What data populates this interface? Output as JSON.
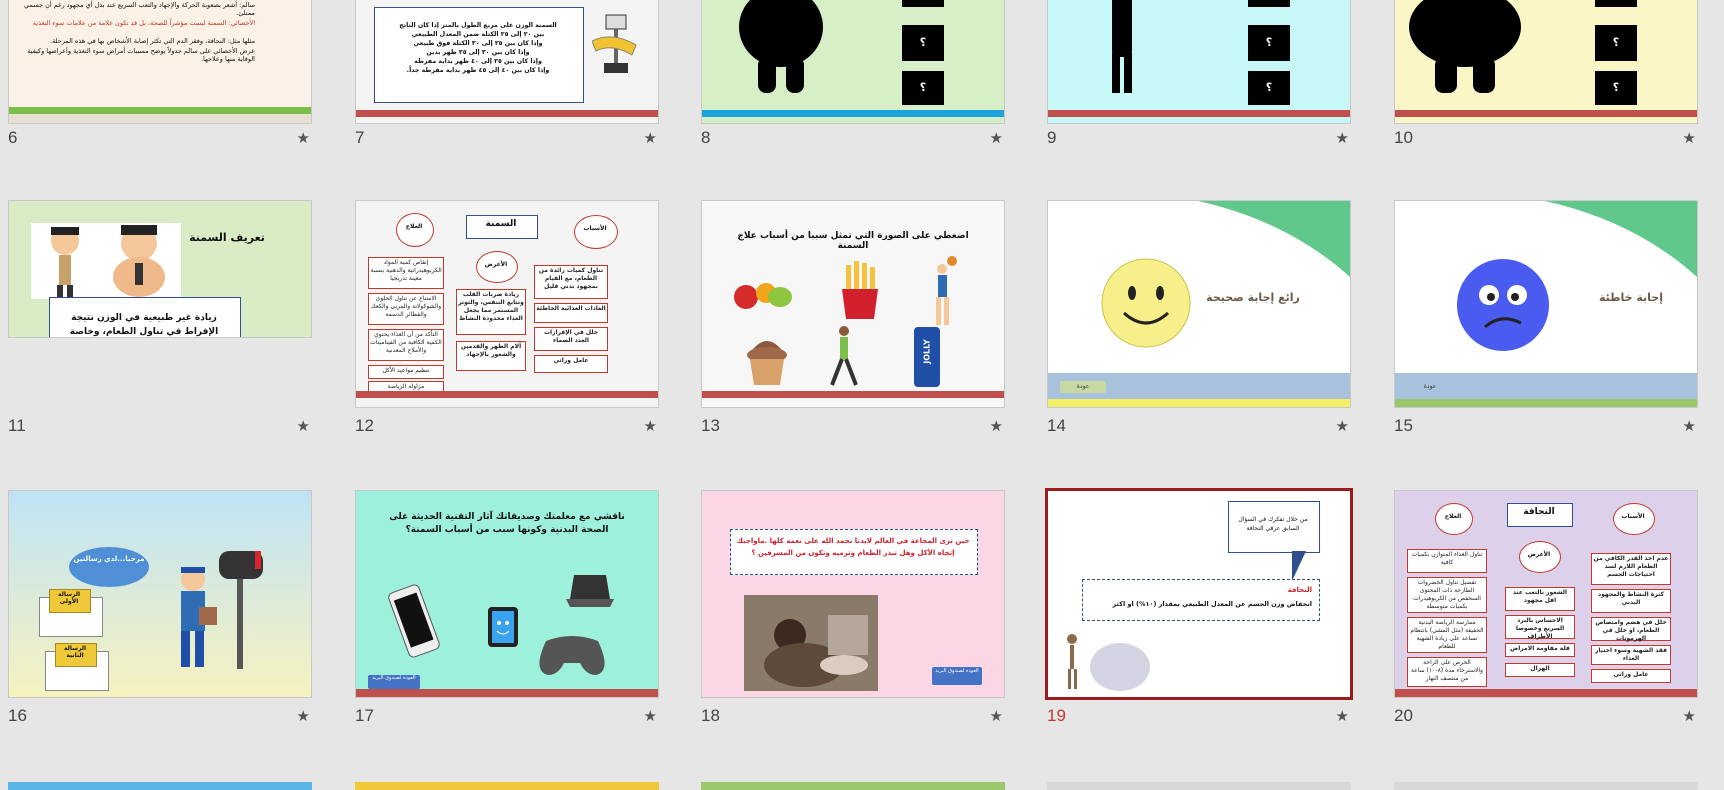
{
  "slides": [
    {
      "number": "6",
      "star": "★",
      "line1": "سالم: أشعر بصعوبة الحركة والإجهاد والتعب السريع عند بذل أي مجهود رغم أن جسمي ممتلئ.",
      "line2": "الأخصائي: السمنة ليست مؤشراً للصحة، بل قد تكون علامة من علامات سوء التغذية",
      "line3": "مثلها مثل: النحافة، وفقر الدم التي تكثر إصابة الأشخاص بها في هذه المرحلة.",
      "line4": "عرض الأخصائي على سالم جدولاً يوضح مسببات أمراض سوء التغذية وأعراضها وكيفية الوقاية منها وعلاجها."
    },
    {
      "number": "7",
      "star": "★",
      "lines": [
        "السمنة الوزن على مربع الطول بالمتر إذا كان الناتج",
        "بين ٢٠ إلى ٢٥ الكتلة ضمن المعدل الطبيعي",
        "وإذا كان بين ٢٥ إلى ٣٠ الكتلة فوق طبيعي",
        "وإذا كان بين ٣٠ إلى ٣٥ ظهر بدين",
        "وإذا كان بين ٣٥ إلى ٤٠ ظهر بداية مفرطة",
        "وإذا كان بين ٤٠ إلى ٤٥ ظهر بداية مفرطة جداً."
      ]
    },
    {
      "number": "8",
      "star": "★",
      "q": "؟"
    },
    {
      "number": "9",
      "star": "★",
      "q": "؟"
    },
    {
      "number": "10",
      "star": "★",
      "q": "؟"
    },
    {
      "number": "11",
      "star": "★",
      "title": "تعريف السمنة",
      "body": "زيادة غير طبيعية في الوزن نتيجة الإفراط في تناول الطعام، وخاصة اعناصر المولدة للطاقة مما يؤدي إلى تراكم دهن في الجسم."
    },
    {
      "number": "12",
      "star": "★",
      "center": "السمنة",
      "causes": "الأسباب",
      "symptoms": "الأعرض",
      "treatment": "العلاج",
      "causes_items": [
        "تناول كميات زائدة من الطعام، مع القيام بمجهود بدني قليل",
        "العادات الغذائية الخاطئة",
        "خلل في الإفرازات الغدد الصماء",
        "عامل وراثي"
      ],
      "symptoms_items": [
        "زيادة ضربات القلب وتتابع التنفس، والتوتر المستمر مما يجعل الغذاء محدودة النشاط",
        "آلام الظهر والقدمين والشعور بالإجهاد"
      ],
      "treatment_items": [
        "إنقاص كمية المواد الكربوهيدراتية والدهنية بنسبة معينة تدريجيا",
        "الامتناع عن تناول الحلوى والشوكولاتة والمربى والكعك والفطائر الدسمة",
        "التأكد من أن الغذاء يحتوي الكمية الكافية من الفيتامينات والأملاح المعدنية",
        "تنظيم مواعيد الأكل",
        "مزاولة الرياضة"
      ]
    },
    {
      "number": "13",
      "star": "★",
      "title": "اضغطي على الصورة التي تمثل سببا من أسباب علاج السمنة",
      "can": "JOLLY"
    },
    {
      "number": "14",
      "star": "★",
      "text": "رائع إجابة صحيحة",
      "back": "عودة"
    },
    {
      "number": "15",
      "star": "★",
      "text": "إجابة خاطئة",
      "back": "عودة"
    },
    {
      "number": "16",
      "star": "★",
      "bubble": "مرحبا...لدي رسالتين",
      "letter1": "الرسالة الأولى",
      "letter2": "الرسالة الثانية"
    },
    {
      "number": "17",
      "star": "★",
      "title": "ناقشي مع معلمتك وصديقاتك آثار التقنية الحديثة على الصحة البدنية وكونها سبب من أسباب السمنة؟",
      "button": "العودة لصندوق البريد"
    },
    {
      "number": "18",
      "star": "★",
      "text": "حين ترى المجاعة في العالم لابدنا نحمد الله على نعمه كلها .ماواجبك إتجاه الأكل وهل تبذر الطعام وترميه وتكون من المسرفين ؟",
      "button": "العودة لصندوق البريد"
    },
    {
      "number": "19",
      "star": "★",
      "callout": "من خلال تفكرك في السؤال السابق عرفي النحافة",
      "label": "النحافة",
      "body": "انخفاض وزن الجسم عن المعدل الطبيعي بمقدار (١٠%) او اكثر"
    },
    {
      "number": "20",
      "star": "★",
      "center": "النحافة",
      "causes": "الأسباب",
      "symptoms": "الأعرض",
      "treatment": "العلاج",
      "causes_items": [
        "عدم اخذ القدر الكافي من الطعام اللازم لسد احتياجات الجسم",
        "كثرة النشاط والمجهود البدني",
        "خلل في هضم وامتصاص الطعام، او خلل في الهرمونات",
        "فقد الشهية وسوء اختيار الغذاء",
        "عامل وراثي"
      ],
      "symptoms_items": [
        "الشعور بالتعب عند اقل مجهود",
        "الاحساس بالبرد السريع وخصوصا الأطراف",
        "قلة مقاومة الامراض",
        "الهزال"
      ],
      "treatment_items": [
        "تناول الغذاء المتوازن بكميات كافية",
        "تفضيل تناول الخضروات الطازجة ذات المحتوى المنخفض من الكربوهيدرات بكميات متوسطة",
        "ممارسة الرياضة البدنية الخفيفة (مثل المشي) بانتظام تساعد على زيادة الشهية للطعام",
        "الحرص على الراحة والاسترخاء مدة (٨-١٠) ساعة من منتصف النهار"
      ]
    }
  ],
  "colors": {
    "selected_border": "#9b1c1c",
    "selected_number": "#c0392b",
    "background": "#e6e6e6"
  }
}
